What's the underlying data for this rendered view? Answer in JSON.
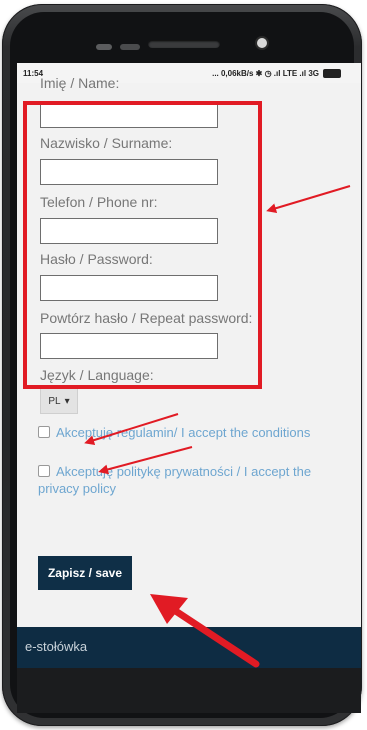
{
  "status_bar": {
    "time": "11:54",
    "indicators": "... 0,06kB/s ✱ ◷ .ıl LTE .ıl 3G"
  },
  "form": {
    "name_label": "Imię / Name:",
    "surname_label": "Nazwisko / Surname:",
    "phone_label": "Telefon / Phone nr:",
    "password_label": "Hasło / Password:",
    "repeat_password_label": "Powtórz hasło / Repeat password:",
    "language_label": "Język / Language:",
    "language_value": "PL",
    "accept_terms": "Akceptuję regulamin/ I accept the conditions",
    "accept_privacy": "Akceptuję politykę prywatności / I accept the privacy policy",
    "save_label": "Zapisz / save"
  },
  "footer": {
    "brand": "e-stołówka"
  },
  "colors": {
    "highlight": "#e11b24",
    "navy": "#0f2f47",
    "link": "#6ea6d0"
  }
}
